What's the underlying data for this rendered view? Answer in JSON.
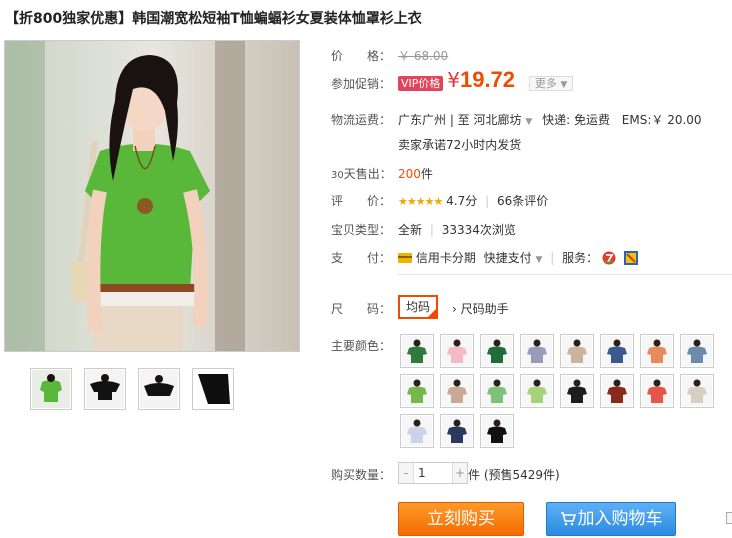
{
  "title": "【折800独家优惠】韩国潮宽松短袖T恤蝙蝠衫女夏装体恤罩衫上衣",
  "price": {
    "label": "价　　格：",
    "original": "￥ 68.00",
    "promo_label": "参加促销：",
    "vip_badge": "VIP价格",
    "currency": "¥",
    "current": "19.72",
    "more": "更多"
  },
  "shipping": {
    "label": "物流运费：",
    "from": "广东广州 | 至",
    "to": "河北廊坊",
    "express": "快递: 免运费",
    "ems": "EMS:￥ 20.00",
    "promise": "卖家承诺72小时内发货"
  },
  "sales": {
    "label_prefix": "30",
    "label": "天售出：",
    "value": "200",
    "unit": "件"
  },
  "rating": {
    "label": "评　　价：",
    "stars": "★★★★★",
    "score": "4.7分",
    "reviews": "66条评价"
  },
  "type": {
    "label": "宝贝类型：",
    "condition": "全新",
    "views": "33334次浏览"
  },
  "payment": {
    "label": "支　　付：",
    "credit": "信用卡分期",
    "quick": "快捷支付",
    "service": "服务："
  },
  "size": {
    "label": "尺　　码：",
    "selected": "均码",
    "helper": "尺码助手"
  },
  "color": {
    "label": "主要颜色：",
    "swatches": [
      "#2e7a3a",
      "#f3b9c4",
      "#1f6d38",
      "#9a9bb8",
      "#c9b59c",
      "#3a5a8e",
      "#e88a5c",
      "#6d8aa8",
      "#78b84a",
      "#c9a995",
      "#7ec27a",
      "#a7d27c",
      "#1d1d1d",
      "#8a2a18",
      "#e4554a",
      "#d6cfc3",
      "#cbd4e6",
      "#2b3a5c",
      "#111111"
    ]
  },
  "quantity": {
    "label": "购买数量：",
    "minus": "-",
    "value": "1",
    "plus": "+",
    "note": "件 (预售5429件)"
  },
  "buttons": {
    "buy": "立刻购买",
    "cart": "加入购物车"
  },
  "colors": {
    "accent": "#f24b00",
    "buy": "#f77b06",
    "cart": "#2a8be0",
    "vip": "#e1455b"
  }
}
